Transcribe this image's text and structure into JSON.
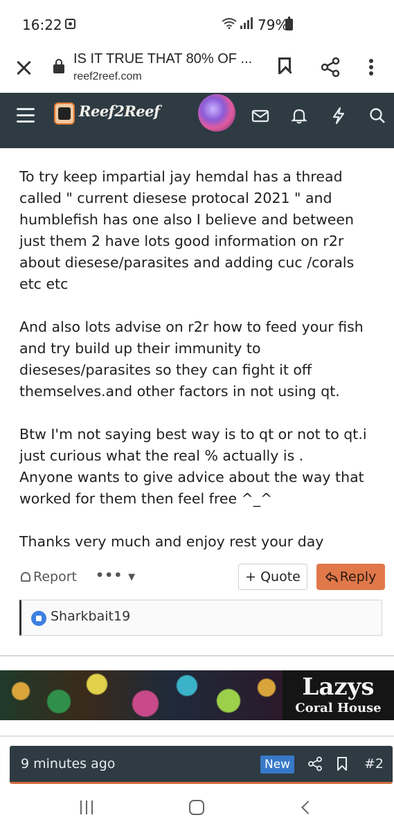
{
  "status_bar": {
    "time": "16:22",
    "battery": "79%"
  },
  "browser": {
    "page_title": "IS IT TRUE THAT 80% OF ...",
    "domain": "reef2reef.com"
  },
  "site_nav": {
    "logo_text": "Reef2Reef",
    "brand_color": "#2e3b43"
  },
  "post": {
    "paragraphs": [
      "To try keep impartial jay hemdal has a thread called \" current diesese protocal 2021 \" and humblefish has one also I believe and between just them 2 have lots good information on r2r about diesese/parasites and adding cuc /corals etc etc",
      "And also lots advise on r2r how to feed your fish and try build up their immunity to dieseses/parasites so they can fight it off themselves.and other factors in not using qt.",
      "Btw I'm not saying best way is to qt or not to qt.i just curious what the real % actually is .\nAnyone wants to give advice about the way that worked for them then feel free ^_^",
      "Thanks very much and enjoy rest your day"
    ],
    "actions": {
      "report_label": "Report",
      "more_label": "•••",
      "quote_label": "+ Quote",
      "reply_label": "Reply",
      "reply_color": "#e0784a"
    },
    "reactions": {
      "user": "Sharkbait19",
      "icon": "like-icon"
    }
  },
  "ad": {
    "title": "Lazys",
    "subtitle": "Coral House"
  },
  "next_post": {
    "time": "9 minutes ago",
    "badge": "New",
    "number": "#2"
  }
}
